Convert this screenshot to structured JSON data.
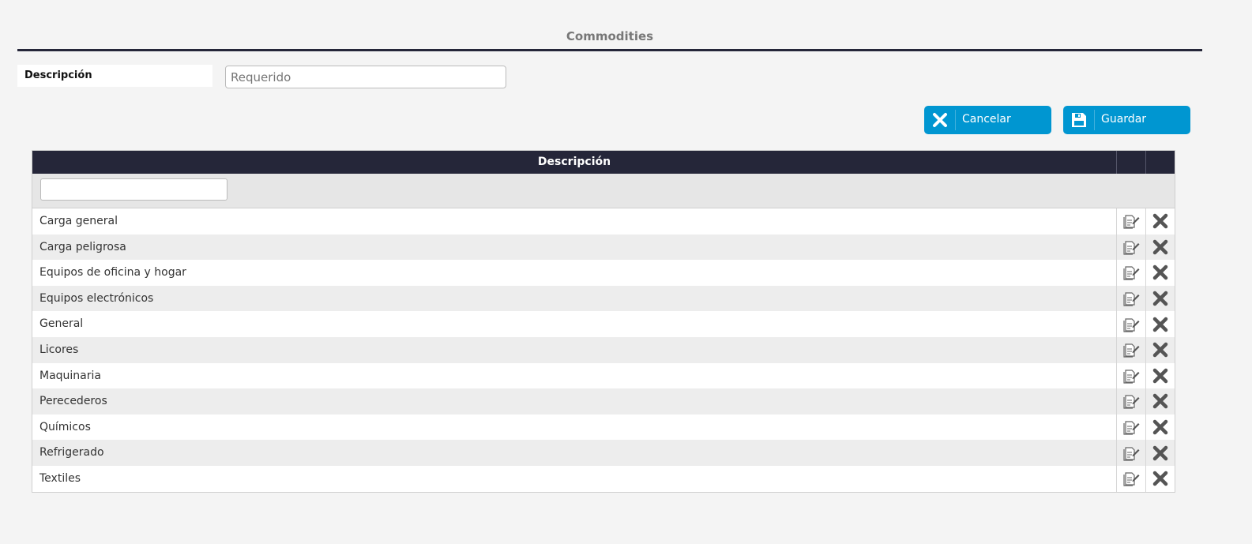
{
  "page": {
    "title": "Commodities"
  },
  "form": {
    "description_label": "Descripción",
    "description_placeholder": "Requerido",
    "description_value": ""
  },
  "buttons": {
    "cancel_label": "Cancelar",
    "cancel_icon": "close-icon",
    "save_label": "Guardar",
    "save_icon": "floppy-disk-icon"
  },
  "colors": {
    "accent": "#0096d1",
    "header_dark": "#252639",
    "delete_icon": "#555555"
  },
  "grid": {
    "columns": [
      "Descripción",
      "",
      ""
    ],
    "filter_value": "",
    "row_actions": [
      "edit-icon",
      "delete-icon"
    ],
    "rows": [
      "Carga general",
      "Carga peligrosa",
      "Equipos de oficina y hogar",
      "Equipos electrónicos",
      "General",
      "Licores",
      "Maquinaria",
      "Perecederos",
      "Químicos",
      "Refrigerado",
      "Textiles"
    ]
  }
}
